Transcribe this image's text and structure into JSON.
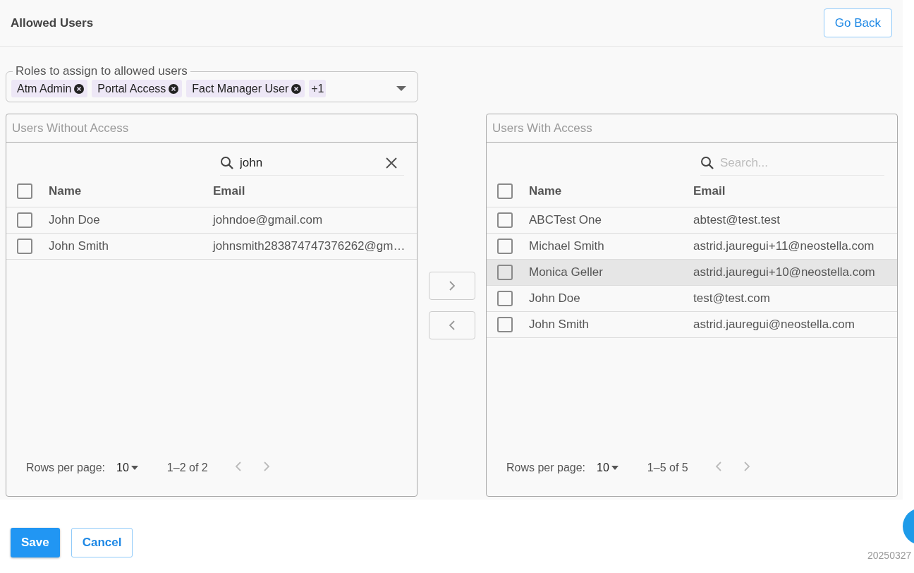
{
  "header": {
    "title": "Allowed Users",
    "back_button": "Go Back"
  },
  "roles": {
    "label": "Roles to assign to allowed users",
    "chips": [
      {
        "label": "Atm Admin"
      },
      {
        "label": "Portal Access"
      },
      {
        "label": "Fact Manager User"
      }
    ],
    "more": "+1"
  },
  "panels": [
    {
      "title": "Users Without Access",
      "search": {
        "value": "john"
      },
      "columns": [
        "Name",
        "Email"
      ],
      "select_all_checked": false,
      "rows": [
        {
          "name": "John Doe",
          "email": "johndoe@gmail.com",
          "checked": false,
          "highlighted": false
        },
        {
          "name": "John Smith",
          "email": "johnsmith283874747376262@gm…",
          "checked": false,
          "highlighted": false
        }
      ],
      "pagination": {
        "label": "Rows per page:",
        "rows_per_page": "10",
        "range": "1–2 of 2",
        "prev_disabled": true,
        "next_disabled": true
      }
    },
    {
      "title": "Users With Access",
      "search": {
        "placeholder": "Search..."
      },
      "columns": [
        "Name",
        "Email"
      ],
      "select_all_checked": false,
      "rows": [
        {
          "name": "ABCTest One",
          "email": "abtest@test.test",
          "checked": false,
          "highlighted": false
        },
        {
          "name": "Michael Smith",
          "email": "astrid.jauregui+11@neostella.com",
          "checked": false,
          "highlighted": false
        },
        {
          "name": "Monica Geller",
          "email": "astrid.jauregui+10@neostella.com",
          "checked": false,
          "highlighted": true
        },
        {
          "name": "John Doe",
          "email": "test@test.com",
          "checked": false,
          "highlighted": false
        },
        {
          "name": "John Smith",
          "email": "astrid.jauregui@neostella.com",
          "checked": false,
          "highlighted": false
        }
      ],
      "pagination": {
        "label": "Rows per page:",
        "rows_per_page": "10",
        "range": "1–5 of 5",
        "prev_disabled": true,
        "next_disabled": true
      }
    }
  ],
  "actions": {
    "save": "Save",
    "cancel": "Cancel"
  },
  "version": "20250327"
}
